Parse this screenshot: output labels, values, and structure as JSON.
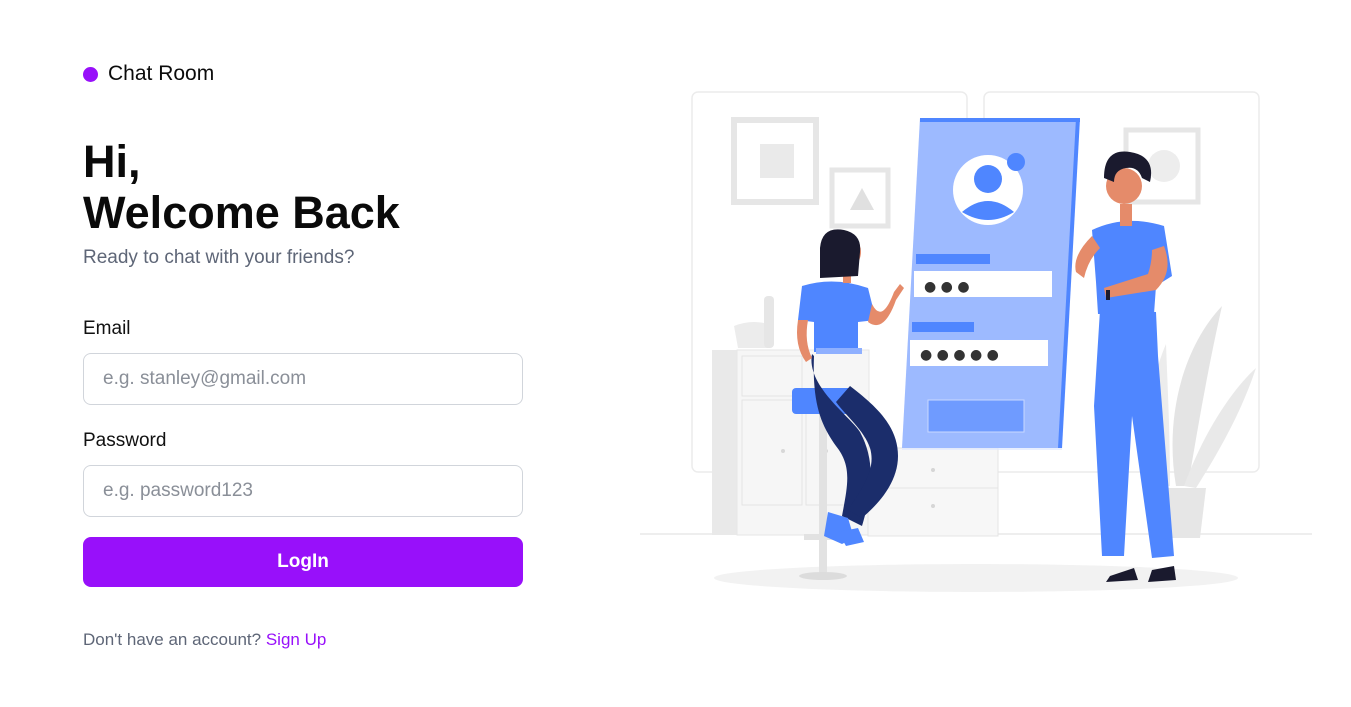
{
  "brand": {
    "name": "Chat Room",
    "accent": "#9810fa"
  },
  "hero": {
    "greeting_line1": "Hi,",
    "greeting_line2": "Welcome Back",
    "subtitle": "Ready to chat with your friends?"
  },
  "form": {
    "email_label": "Email",
    "email_placeholder": "e.g. stanley@gmail.com",
    "email_value": "",
    "password_label": "Password",
    "password_placeholder": "e.g. password123",
    "password_value": "",
    "login_label": "LogIn"
  },
  "signup": {
    "prompt": "Don't have an account? ",
    "link_label": "Sign Up"
  },
  "illustration": {
    "subject": "login-illustration",
    "password_dots_1": "● ● ●",
    "password_dots_2": "● ● ● ● ●"
  }
}
